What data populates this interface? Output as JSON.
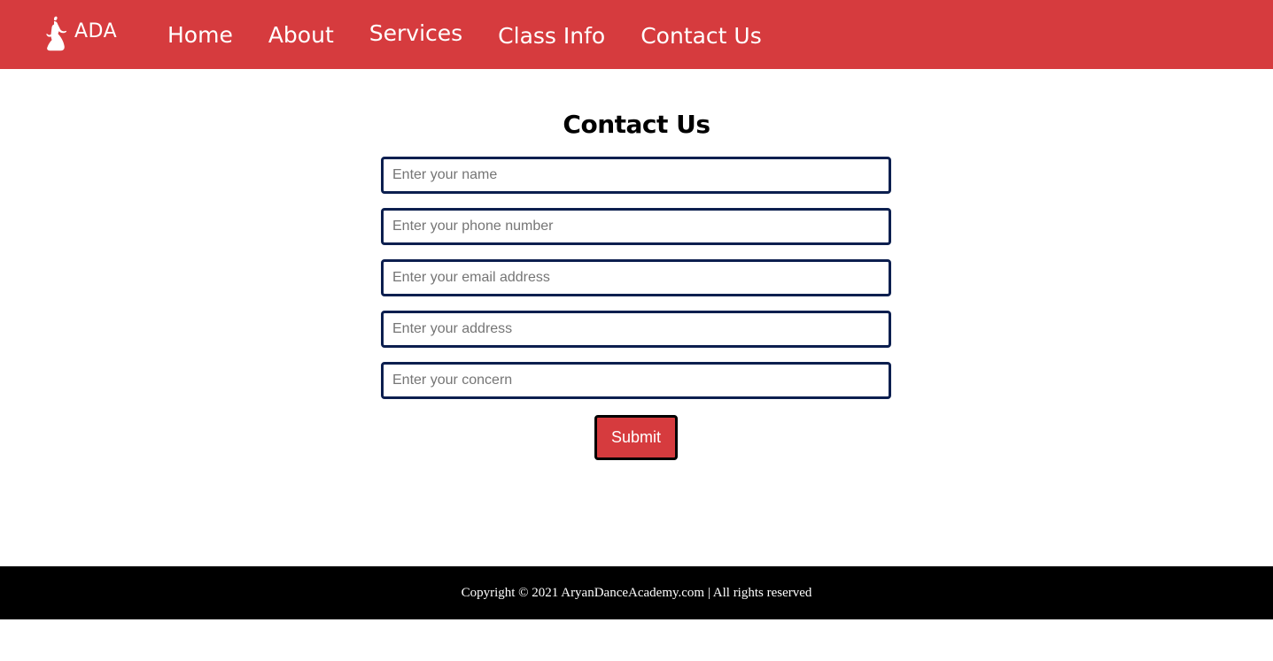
{
  "colors": {
    "brand_red": "#d63b3e",
    "input_border": "#0c1f4f",
    "footer_bg": "#000000"
  },
  "navbar": {
    "logo_text": "ADA",
    "logo_icon": "dancer-icon",
    "items": [
      {
        "label": "Home"
      },
      {
        "label": "About"
      },
      {
        "label": "Services"
      },
      {
        "label": "Class Info"
      },
      {
        "label": "Contact Us"
      }
    ]
  },
  "form": {
    "title": "Contact Us",
    "fields": [
      {
        "placeholder": "Enter your name",
        "value": ""
      },
      {
        "placeholder": "Enter your phone number",
        "value": ""
      },
      {
        "placeholder": "Enter your email address",
        "value": ""
      },
      {
        "placeholder": "Enter your address",
        "value": ""
      },
      {
        "placeholder": "Enter your concern",
        "value": ""
      }
    ],
    "submit_label": "Submit"
  },
  "footer": {
    "text": "Copyright © 2021 AryanDanceAcademy.com | All rights reserved"
  }
}
